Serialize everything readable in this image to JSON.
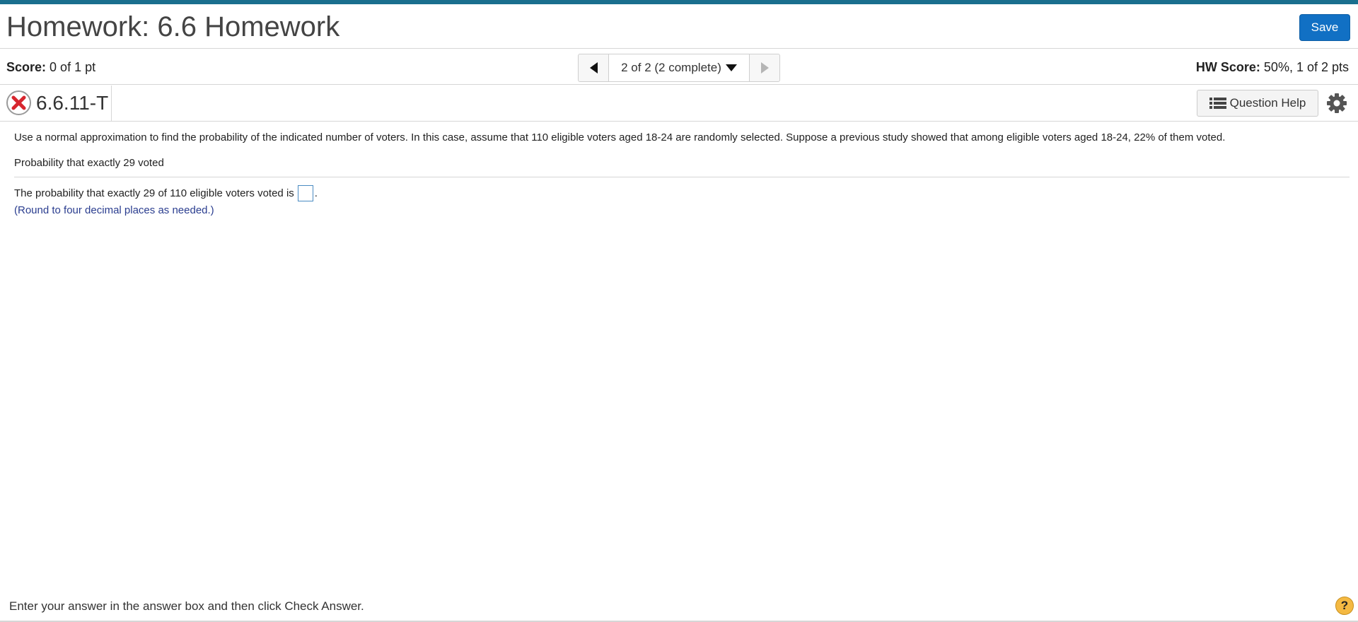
{
  "header": {
    "title": "Homework: 6.6 Homework",
    "save_label": "Save"
  },
  "score_bar": {
    "score_label": "Score:",
    "score_value": "0 of 1 pt",
    "nav_position": "2 of 2 (2 complete)",
    "hw_score_label": "HW Score:",
    "hw_score_value": "50%, 1 of 2 pts"
  },
  "question": {
    "status_icon": "x-circle-icon",
    "id": "6.6.11-T",
    "help_label": "Question Help",
    "prompt": "Use a normal approximation to find the probability of the indicated number of voters. In this case, assume that 110 eligible voters aged 18-24 are randomly selected. Suppose a previous study showed that among eligible voters aged 18-24, 22% of them voted.",
    "subprompt": "Probability that exactly 29 voted",
    "answer_prefix": "The probability that exactly 29 of 110 eligible voters voted is",
    "answer_value": "",
    "answer_suffix": ".",
    "rounding_note": "(Round to four decimal places as needed.)"
  },
  "footer": {
    "instruction": "Enter your answer in the answer box and then click Check Answer.",
    "help_glyph": "?"
  },
  "colors": {
    "accent": "#1a6f8e",
    "save_button": "#1170c4",
    "incorrect": "#d7262e",
    "note_text": "#2a3d8f",
    "help_badge": "#f4b942"
  }
}
